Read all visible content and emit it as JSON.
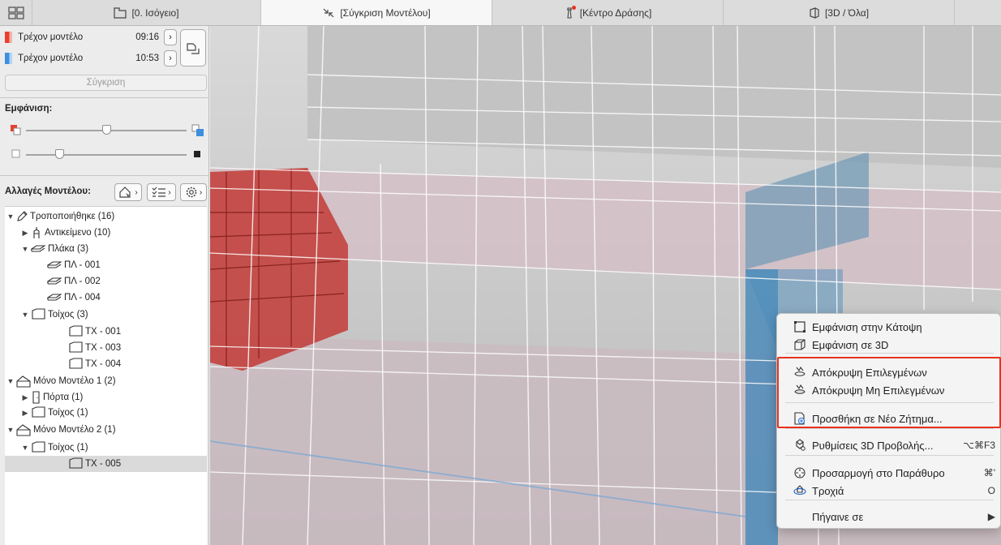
{
  "tabs": [
    {
      "label": "[0. Ισόγειο]",
      "icon": "floor-plan-icon"
    },
    {
      "label": "[Σύγκριση Μοντέλου]",
      "icon": "compare-arrows-icon"
    },
    {
      "label": "[Κέντρο Δράσης]",
      "icon": "lighthouse-icon"
    },
    {
      "label": "[3D / Όλα]",
      "icon": "3d-view-icon"
    }
  ],
  "compare": {
    "model_a": {
      "label": "Τρέχον μοντέλο",
      "time": "09:16",
      "color": "#e8402e"
    },
    "model_b": {
      "label": "Τρέχον μοντέλο",
      "time": "10:53",
      "color": "#3d8fe0"
    },
    "compare_button": "Σύγκριση"
  },
  "display": {
    "title": "Εμφάνιση:",
    "color_slider_level": 0.5,
    "opacity_slider_level": 0.19
  },
  "changes": {
    "title": "Αλλαγές Μοντέλου:"
  },
  "tree": [
    {
      "label": "Τροποποιήθηκε (16)",
      "icon": "pencil-icon",
      "state": "open"
    },
    {
      "label": "Αντικείμενο (10)",
      "icon": "object-icon",
      "state": "closed"
    },
    {
      "label": "Πλάκα (3)",
      "icon": "slab-icon",
      "state": "open"
    },
    {
      "label": "ΠΛ - 001",
      "icon": "slab-icon"
    },
    {
      "label": "ΠΛ - 002",
      "icon": "slab-icon"
    },
    {
      "label": "ΠΛ - 004",
      "icon": "slab-icon"
    },
    {
      "label": "Τοίχος (3)",
      "icon": "wall-icon",
      "state": "open"
    },
    {
      "label": "ΤΧ - 001",
      "icon": "wall-icon"
    },
    {
      "label": "ΤΧ - 003",
      "icon": "wall-icon"
    },
    {
      "label": "ΤΧ - 004",
      "icon": "wall-icon"
    },
    {
      "label": "Μόνο Μοντέλο 1 (2)",
      "icon": "house-icon",
      "state": "open"
    },
    {
      "label": "Πόρτα (1)",
      "icon": "door-icon",
      "state": "closed"
    },
    {
      "label": "Τοίχος (1)",
      "icon": "wall-icon",
      "state": "closed"
    },
    {
      "label": "Μόνο Μοντέλο 2 (1)",
      "icon": "house-icon",
      "state": "open"
    },
    {
      "label": "Τοίχος (1)",
      "icon": "wall-icon",
      "state": "open"
    },
    {
      "label": "ΤΧ - 005",
      "icon": "wall-icon",
      "selected": true
    }
  ],
  "menu": [
    {
      "label": "Εμφάνιση στην Κάτοψη",
      "icon": "show-in-plan-icon",
      "shortcut": ""
    },
    {
      "label": "Εμφάνιση σε 3D",
      "icon": "show-in-3d-icon",
      "shortcut": ""
    },
    {
      "label": "Απόκρυψη Επιλεγμένων",
      "icon": "hide-selected-icon",
      "shortcut": ""
    },
    {
      "label": "Απόκρυψη Μη Επιλεγμένων",
      "icon": "hide-unselected-icon",
      "shortcut": ""
    },
    {
      "label": "Προσθήκη σε Νέο Ζήτημα...",
      "icon": "add-issue-icon",
      "shortcut": ""
    },
    {
      "label": "Ρυθμίσεις 3D Προβολής...",
      "icon": "3d-settings-icon",
      "shortcut": "⌥⌘F3"
    },
    {
      "label": "Προσαρμογή στο Παράθυρο",
      "icon": "fit-window-icon",
      "shortcut": "⌘'"
    },
    {
      "label": "Τροχιά",
      "icon": "orbit-icon",
      "shortcut": "O"
    },
    {
      "label": "Πήγαινε σε",
      "icon": "",
      "shortcut": "▶"
    }
  ],
  "colors": {
    "highlight": "#e8321e",
    "model_a": "#e8402e",
    "model_b": "#3d8fe0"
  }
}
